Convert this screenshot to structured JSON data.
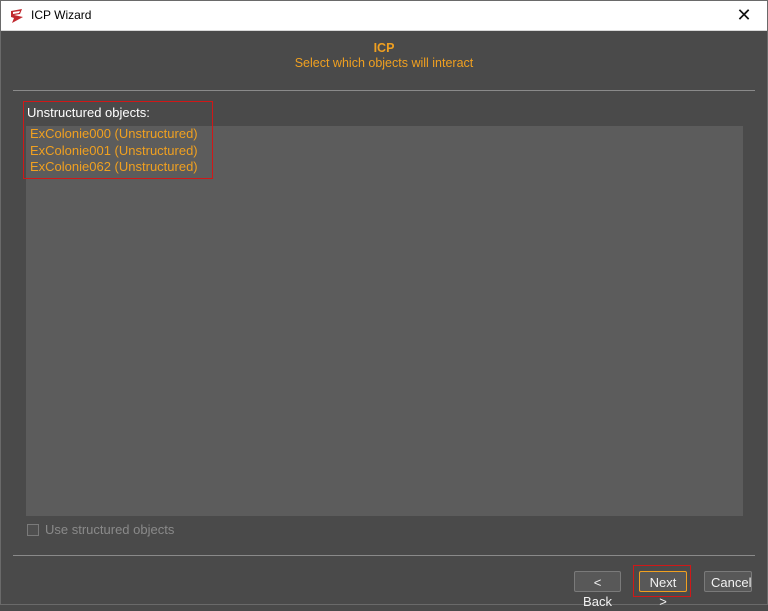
{
  "window": {
    "title": "ICP Wizard"
  },
  "header": {
    "title": "ICP",
    "subtitle": "Select which objects will interact"
  },
  "list": {
    "label": "Unstructured objects:",
    "items": [
      "ExColonie000 (Unstructured)",
      "ExColonie001 (Unstructured)",
      "ExColonie062 (Unstructured)"
    ]
  },
  "options": {
    "use_structured_label": "Use structured objects",
    "use_structured_checked": false
  },
  "buttons": {
    "back": "< Back",
    "next": "Next >",
    "cancel": "Cancel"
  },
  "colors": {
    "accent": "#f0a020",
    "panel": "#5c5c5c",
    "background": "#4a4a4a",
    "highlight": "#d01818"
  },
  "icons": {
    "app": "app-logo-icon",
    "close": "close-icon"
  }
}
